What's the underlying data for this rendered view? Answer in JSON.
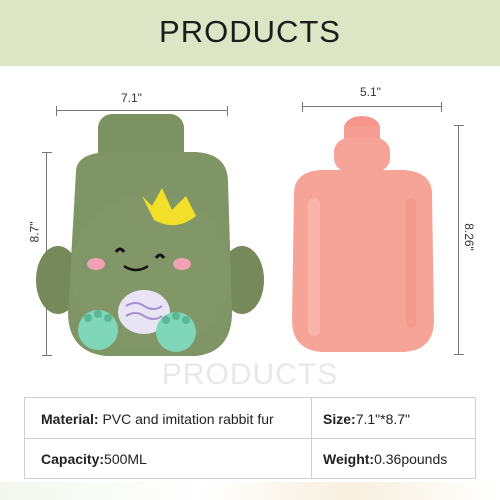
{
  "header": {
    "title": "PRODUCTS"
  },
  "subtitle": "PRODUCTS",
  "dimensions": {
    "left_width": "7.1\"",
    "left_height": "8.7\"",
    "right_width": "5.1\"",
    "right_height": "8.26\""
  },
  "specs": {
    "material_label": "Material:",
    "material_value": " PVC and imitation rabbit fur",
    "size_label": "Size:",
    "size_value": "7.1\"*8.7\"",
    "capacity_label": "Capacity:",
    "capacity_value": "500ML",
    "weight_label": "Weight:",
    "weight_value": "0.36pounds"
  },
  "colors": {
    "header_bg": "#dce6c5",
    "plush_green": "#7c9262",
    "bottle_pink": "#f6a497",
    "crown_yellow": "#f2df2a"
  }
}
